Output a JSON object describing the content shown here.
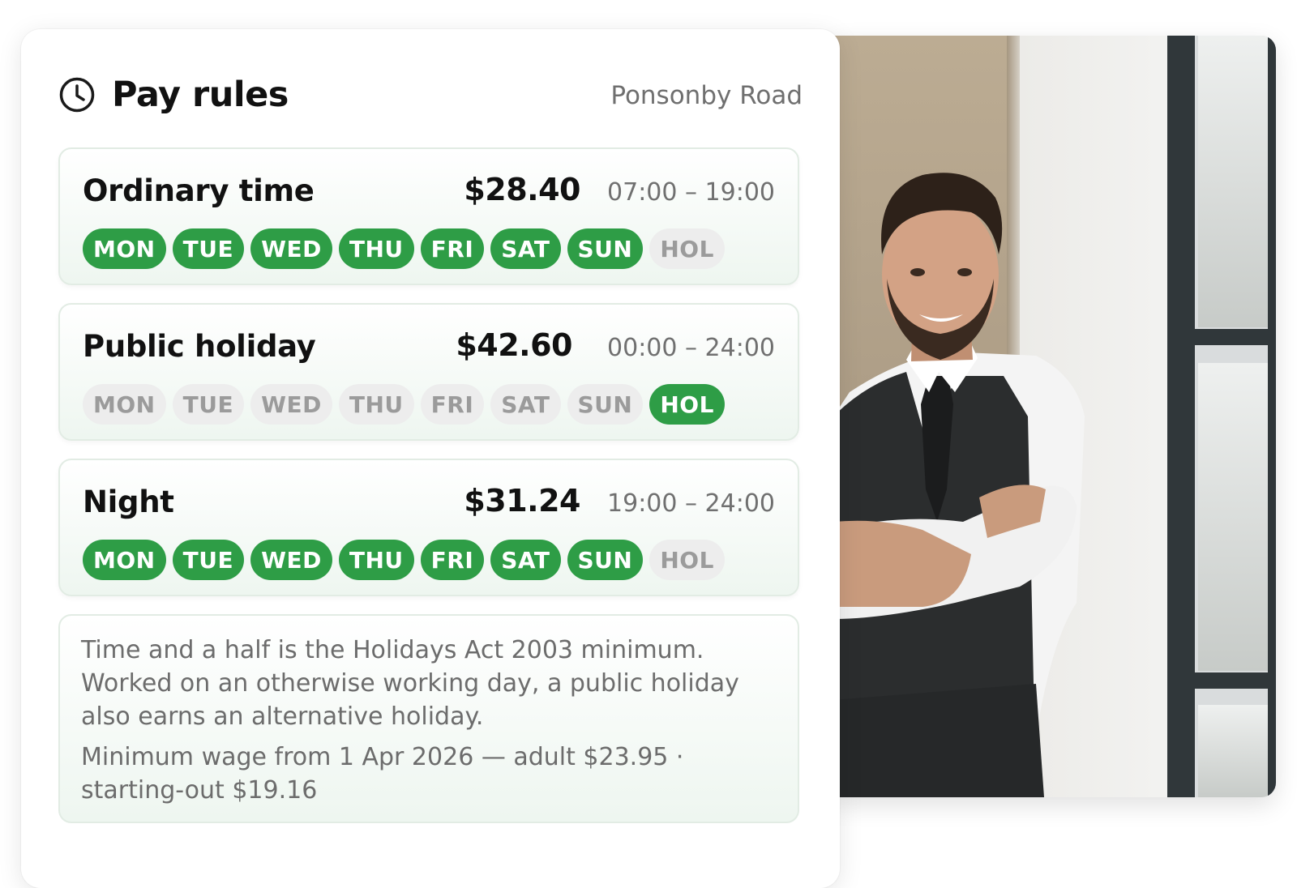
{
  "header": {
    "title": "Pay rules",
    "location": "Ponsonby Road"
  },
  "rules": [
    {
      "name": "Ordinary time",
      "rate": "$28.40",
      "hours": "07:00 – 19:00",
      "days": [
        {
          "label": "MON",
          "active": true
        },
        {
          "label": "TUE",
          "active": true
        },
        {
          "label": "WED",
          "active": true
        },
        {
          "label": "THU",
          "active": true
        },
        {
          "label": "FRI",
          "active": true
        },
        {
          "label": "SAT",
          "active": true
        },
        {
          "label": "SUN",
          "active": true
        },
        {
          "label": "HOL",
          "active": false
        }
      ]
    },
    {
      "name": "Public holiday",
      "rate": "$42.60",
      "hours": "00:00 – 24:00",
      "days": [
        {
          "label": "MON",
          "active": false
        },
        {
          "label": "TUE",
          "active": false
        },
        {
          "label": "WED",
          "active": false
        },
        {
          "label": "THU",
          "active": false
        },
        {
          "label": "FRI",
          "active": false
        },
        {
          "label": "SAT",
          "active": false
        },
        {
          "label": "SUN",
          "active": false
        },
        {
          "label": "HOL",
          "active": true
        }
      ]
    },
    {
      "name": "Night",
      "rate": "$31.24",
      "hours": "19:00 – 24:00",
      "days": [
        {
          "label": "MON",
          "active": true
        },
        {
          "label": "TUE",
          "active": true
        },
        {
          "label": "WED",
          "active": true
        },
        {
          "label": "THU",
          "active": true
        },
        {
          "label": "FRI",
          "active": true
        },
        {
          "label": "SAT",
          "active": true
        },
        {
          "label": "SUN",
          "active": true
        },
        {
          "label": "HOL",
          "active": false
        }
      ]
    }
  ],
  "note": {
    "paragraph1": "Time and a half is the Holidays Act 2003 minimum. Worked on an otherwise working day, a public holiday also earns an alternative holiday.",
    "paragraph2": "Minimum wage from 1 Apr 2026 — adult $23.95 · starting-out $19.16"
  },
  "icons": {
    "header": "clock-icon"
  },
  "colors": {
    "accent": "#2e9d46",
    "chip_off_bg": "#ededed",
    "chip_off_text": "#9b9b9b",
    "title": "#111111",
    "muted": "#6f6f6f"
  }
}
